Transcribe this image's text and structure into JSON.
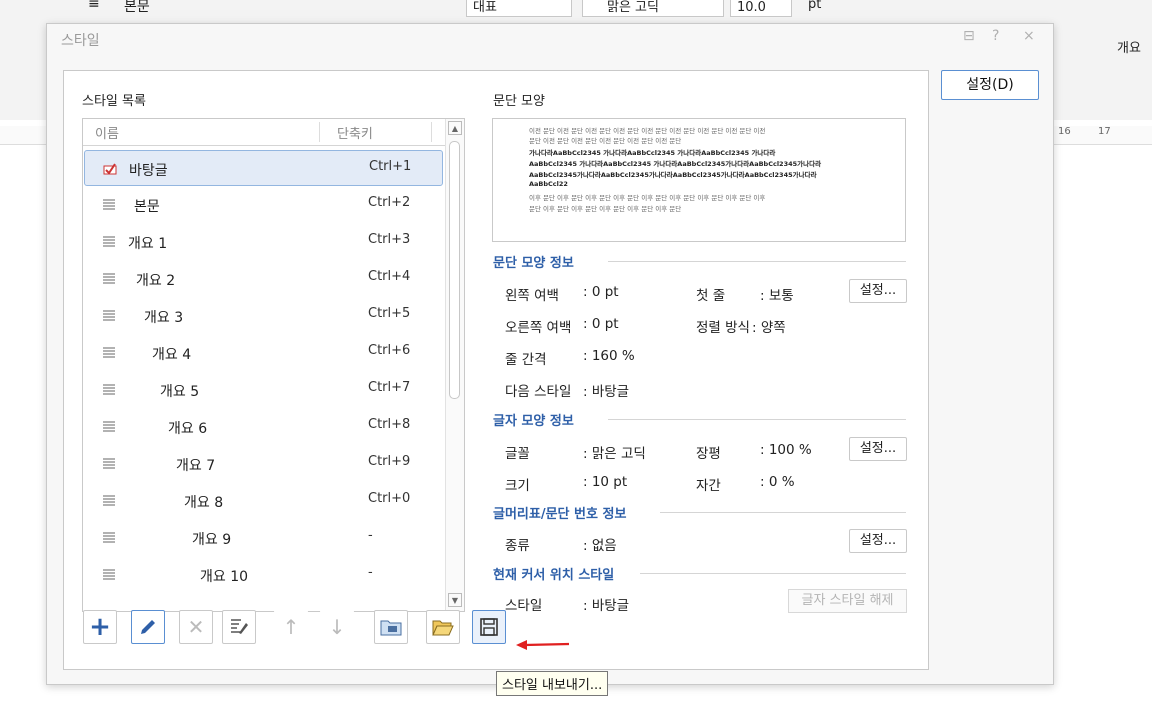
{
  "background_app": {
    "toolbar": {
      "para_style_value": "본문",
      "style_box_value": "대표",
      "font_box_value": "맑은 고딕",
      "size_value": "10.0",
      "unit_value": "pt",
      "outline_label": "개요"
    },
    "ruler": {
      "marks": [
        "16",
        "17"
      ]
    }
  },
  "dialog": {
    "title": "스타일",
    "title_buttons": [
      "⊟",
      "?",
      "×"
    ],
    "settings_button": "설정(D)",
    "style_list": {
      "section_label": "스타일 목록",
      "columns": [
        "이름",
        "단축키"
      ],
      "rows": [
        {
          "name": "바탕글",
          "shortcut": "Ctrl+1",
          "indent": 0,
          "selected": true,
          "icon": "checked-paragraph-icon"
        },
        {
          "name": "본문",
          "shortcut": "Ctrl+2",
          "indent": 6,
          "selected": false,
          "icon": "paragraph-lines-icon"
        },
        {
          "name": "개요 1",
          "shortcut": "Ctrl+3",
          "indent": 0,
          "selected": false,
          "icon": "paragraph-lines-icon"
        },
        {
          "name": "개요 2",
          "shortcut": "Ctrl+4",
          "indent": 8,
          "selected": false,
          "icon": "paragraph-lines-icon"
        },
        {
          "name": "개요 3",
          "shortcut": "Ctrl+5",
          "indent": 16,
          "selected": false,
          "icon": "paragraph-lines-icon"
        },
        {
          "name": "개요 4",
          "shortcut": "Ctrl+6",
          "indent": 24,
          "selected": false,
          "icon": "paragraph-lines-icon"
        },
        {
          "name": "개요 5",
          "shortcut": "Ctrl+7",
          "indent": 32,
          "selected": false,
          "icon": "paragraph-lines-icon"
        },
        {
          "name": "개요 6",
          "shortcut": "Ctrl+8",
          "indent": 40,
          "selected": false,
          "icon": "paragraph-lines-icon"
        },
        {
          "name": "개요 7",
          "shortcut": "Ctrl+9",
          "indent": 48,
          "selected": false,
          "icon": "paragraph-lines-icon"
        },
        {
          "name": "개요 8",
          "shortcut": "Ctrl+0",
          "indent": 56,
          "selected": false,
          "icon": "paragraph-lines-icon"
        },
        {
          "name": "개요 9",
          "shortcut": "-",
          "indent": 64,
          "selected": false,
          "icon": "paragraph-lines-icon"
        },
        {
          "name": "개요 10",
          "shortcut": "-",
          "indent": 72,
          "selected": false,
          "icon": "paragraph-lines-icon"
        }
      ]
    },
    "preview": {
      "section_label": "문단 모양",
      "lines": [
        "이전 문단 이전 문단 이전 문단 이전 문단 이전 문단 이전 문단 이전 문단 이전 문단 이전",
        "문단 이전 문단 이전 문단 이전 문단 이전 문단 이전 문단",
        "가나다라AaBbCcl2345       가나다라AaBbCcl2345       가나다라AaBbCcl2345       가나다라",
        "AaBbCcl2345  가나다라AaBbCcl2345  가나다라AaBbCcl2345가나다라AaBbCcl2345가나다라",
        "AaBbCcl2345가나다라AaBbCcl2345가나다라AaBbCcl2345가나다라AaBbCcl2345가나다라",
        "AaBbCcl22",
        "이후 문단 이후 문단 이후 문단 이후 문단 이후 문단 이후 문단 이후 문단 이후 문단 이후",
        "문단 이후 문단 이후 문단 이후 문단 이후 문단 이후 문단"
      ]
    },
    "para_info": {
      "title": "문단 모양 정보",
      "left_margin_label": "왼쪽 여백",
      "left_margin_value": ": 0 pt",
      "first_line_label": "첫 줄",
      "first_line_value": ": 보통",
      "right_margin_label": "오른쪽 여백",
      "right_margin_value": ": 0 pt",
      "align_label": "정렬 방식",
      "align_value": ": 양쪽",
      "line_spacing_label": "줄 간격",
      "line_spacing_value": ": 160 %",
      "next_style_label": "다음 스타일",
      "next_style_value": ": 바탕글",
      "button": "설정..."
    },
    "char_info": {
      "title": "글자 모양 정보",
      "font_label": "글꼴",
      "font_value": ": 맑은 고딕",
      "width_label": "장평",
      "width_value": ": 100 %",
      "size_label": "크기",
      "size_value": ": 10 pt",
      "spacing_label": "자간",
      "spacing_value": ": 0 %",
      "button": "설정..."
    },
    "bullet_info": {
      "title": "글머리표/문단 번호 정보",
      "type_label": "종류",
      "type_value": ": 없음",
      "button": "설정..."
    },
    "cursor_info": {
      "title": "현재 커서 위치 스타일",
      "style_label": "스타일",
      "style_value": ": 바탕글",
      "unset_button": "글자 스타일 해제"
    },
    "tooltip": "스타일 내보내기...",
    "colors": {
      "accent": "#2e5fa8",
      "arrow": "#e02020",
      "selection": "#e3ebf7"
    }
  }
}
